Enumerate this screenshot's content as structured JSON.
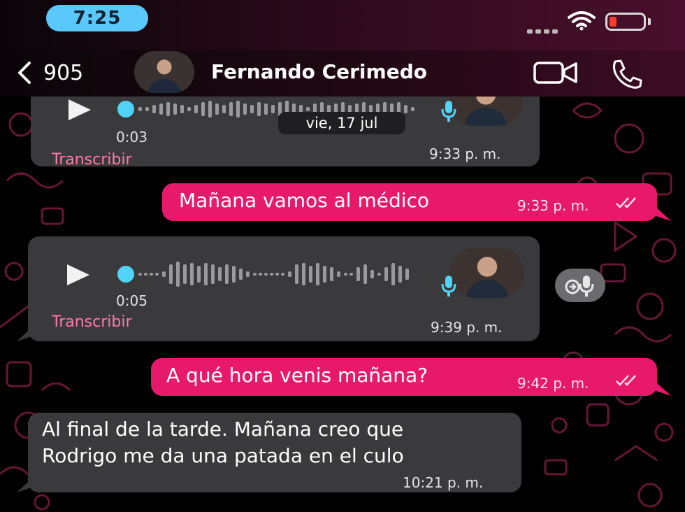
{
  "status_bar": {
    "time": "7:25"
  },
  "header": {
    "back_label": "905",
    "contact_name": "Fernando Cerimedo"
  },
  "chat": {
    "date_chip": "vie, 17 jul",
    "messages": [
      {
        "type": "voice",
        "direction": "incoming",
        "duration": "0:03",
        "transcribe_label": "Transcribir",
        "time": "9:33 p. m."
      },
      {
        "type": "text",
        "direction": "outgoing",
        "text": "Mañana vamos al médico",
        "time": "9:33 p. m."
      },
      {
        "type": "voice",
        "direction": "incoming",
        "duration": "0:05",
        "transcribe_label": "Transcribir",
        "time": "9:39 p. m."
      },
      {
        "type": "text",
        "direction": "outgoing",
        "text": "A qué hora venis mañana?",
        "time": "9:42 p. m."
      },
      {
        "type": "text",
        "direction": "incoming",
        "text_line1": "Al final de la tarde. Mañana creo que",
        "text_line2": "Rodrigo me da una patada en el culo",
        "time": "10:21 p. m."
      }
    ]
  },
  "colors": {
    "outgoing_bubble": "#e8196b",
    "incoming_bubble": "#3a3a3c",
    "voice_progress": "#4fd3f7",
    "transcribe_link": "#ff79a8",
    "time_pill": "#5ac8fa"
  }
}
